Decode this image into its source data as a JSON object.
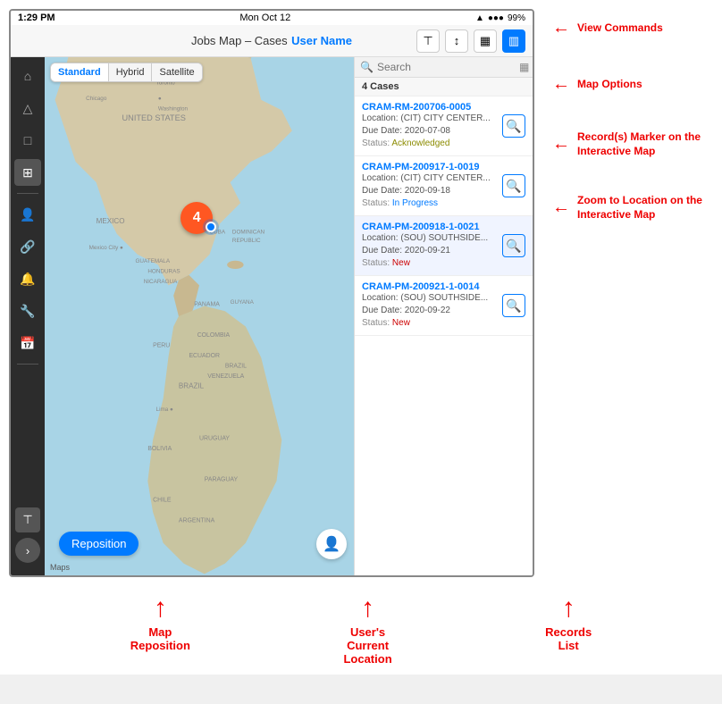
{
  "status_bar": {
    "time": "1:29 PM",
    "day": "Mon Oct 12",
    "wifi": "📶",
    "battery": "99%"
  },
  "header": {
    "title": "Jobs Map – Cases",
    "username": "User Name",
    "icons": [
      "filter",
      "sort",
      "calendar",
      "panel"
    ]
  },
  "map_type_selector": {
    "buttons": [
      "Standard",
      "Hybrid",
      "Satellite"
    ],
    "active": "Standard"
  },
  "map": {
    "cluster_count": "4",
    "reposition_label": "Reposition",
    "maps_credit": "Maps",
    "search_placeholder": "Search"
  },
  "records_panel": {
    "cases_count": "4 Cases",
    "records": [
      {
        "id": "CRAM-RM-200706-0005",
        "location": "Location: (CIT) CITY CENTER...",
        "due_date": "Due Date: 2020-07-08",
        "status": "Acknowledged",
        "status_class": "status-acknowledged"
      },
      {
        "id": "CRAM-PM-200917-1-0019",
        "location": "Location: (CIT) CITY CENTER...",
        "due_date": "Due Date: 2020-09-18",
        "status": "In Progress",
        "status_class": "status-in-progress"
      },
      {
        "id": "CRAM-PM-200918-1-0021",
        "location": "Location: (SOU) SOUTHSIDE...",
        "due_date": "Due Date: 2020-09-21",
        "status": "New",
        "status_class": "status-new"
      },
      {
        "id": "CRAM-PM-200921-1-0014",
        "location": "Location: (SOU) SOUTHSIDE...",
        "due_date": "Due Date: 2020-09-22",
        "status": "New",
        "status_class": "status-new"
      }
    ]
  },
  "annotations": {
    "right": [
      {
        "label": "View Commands"
      },
      {
        "label": "Map Options"
      },
      {
        "label": "Record(s) Marker\non the Interactive Map"
      },
      {
        "label": "Zoom to Location on\nthe Interactive Map"
      }
    ],
    "bottom": [
      {
        "label": "Map\nReposition"
      },
      {
        "label": "User's\nCurrent\nLocation"
      },
      {
        "label": "Records\nList"
      }
    ]
  },
  "sidebar_icons": [
    "home",
    "triangle",
    "square",
    "map",
    "person",
    "link",
    "bell",
    "wrench",
    "calendar",
    "filter",
    "chevron"
  ]
}
